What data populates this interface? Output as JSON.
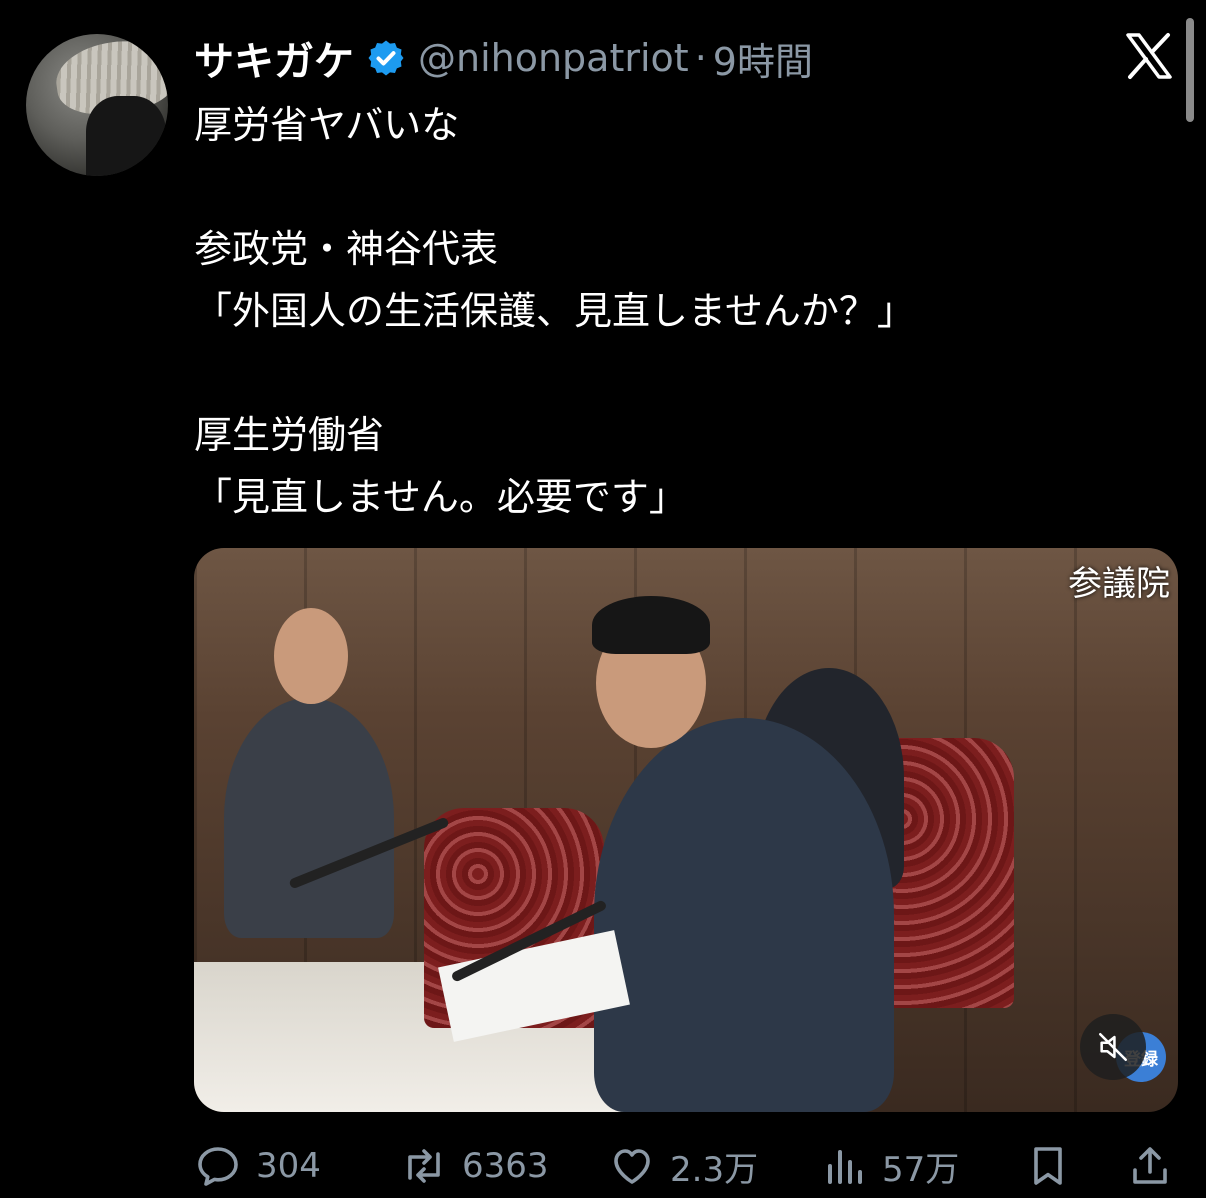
{
  "tweet": {
    "author_name": "サキガケ",
    "handle": "@nihonpatriot",
    "separator": "·",
    "time": "9時間",
    "lines": [
      "厚労省ヤバいな",
      "",
      "参政党・神谷代表",
      "「外国人の生活保護、見直しませんか？」",
      "",
      "厚生労働省",
      "「見直しません。必要です」"
    ]
  },
  "media": {
    "watermark": "参議院",
    "channel_badge": "登録",
    "mute_icon": "speaker-muted-icon"
  },
  "actions": {
    "replies": "304",
    "reposts": "6363",
    "likes": "2.3万",
    "views": "57万"
  },
  "colors": {
    "background": "#000000",
    "text": "#ffffff",
    "secondary_text": "#8b98a5",
    "verified": "#1d9bf0"
  },
  "icons": [
    "verified-badge-icon",
    "x-logo-icon",
    "reply-icon",
    "repost-icon",
    "like-icon",
    "views-icon",
    "bookmark-icon",
    "share-icon"
  ]
}
